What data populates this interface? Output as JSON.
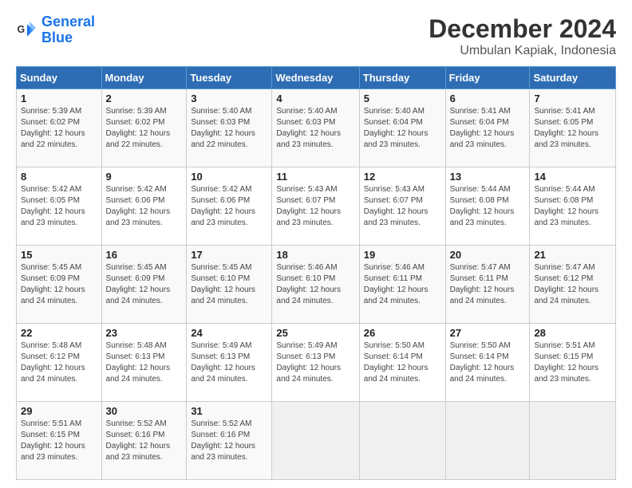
{
  "logo": {
    "text_general": "General",
    "text_blue": "Blue"
  },
  "header": {
    "title": "December 2024",
    "subtitle": "Umbulan Kapiak, Indonesia"
  },
  "calendar": {
    "days_of_week": [
      "Sunday",
      "Monday",
      "Tuesday",
      "Wednesday",
      "Thursday",
      "Friday",
      "Saturday"
    ],
    "weeks": [
      [
        null,
        {
          "day": "2",
          "sunrise": "Sunrise: 5:39 AM",
          "sunset": "Sunset: 6:02 PM",
          "daylight": "Daylight: 12 hours and 22 minutes."
        },
        {
          "day": "3",
          "sunrise": "Sunrise: 5:40 AM",
          "sunset": "Sunset: 6:03 PM",
          "daylight": "Daylight: 12 hours and 22 minutes."
        },
        {
          "day": "4",
          "sunrise": "Sunrise: 5:40 AM",
          "sunset": "Sunset: 6:03 PM",
          "daylight": "Daylight: 12 hours and 23 minutes."
        },
        {
          "day": "5",
          "sunrise": "Sunrise: 5:40 AM",
          "sunset": "Sunset: 6:04 PM",
          "daylight": "Daylight: 12 hours and 23 minutes."
        },
        {
          "day": "6",
          "sunrise": "Sunrise: 5:41 AM",
          "sunset": "Sunset: 6:04 PM",
          "daylight": "Daylight: 12 hours and 23 minutes."
        },
        {
          "day": "7",
          "sunrise": "Sunrise: 5:41 AM",
          "sunset": "Sunset: 6:05 PM",
          "daylight": "Daylight: 12 hours and 23 minutes."
        }
      ],
      [
        {
          "day": "1",
          "sunrise": "Sunrise: 5:39 AM",
          "sunset": "Sunset: 6:02 PM",
          "daylight": "Daylight: 12 hours and 22 minutes."
        },
        null,
        null,
        null,
        null,
        null,
        null
      ],
      [
        {
          "day": "8",
          "sunrise": "Sunrise: 5:42 AM",
          "sunset": "Sunset: 6:05 PM",
          "daylight": "Daylight: 12 hours and 23 minutes."
        },
        {
          "day": "9",
          "sunrise": "Sunrise: 5:42 AM",
          "sunset": "Sunset: 6:06 PM",
          "daylight": "Daylight: 12 hours and 23 minutes."
        },
        {
          "day": "10",
          "sunrise": "Sunrise: 5:42 AM",
          "sunset": "Sunset: 6:06 PM",
          "daylight": "Daylight: 12 hours and 23 minutes."
        },
        {
          "day": "11",
          "sunrise": "Sunrise: 5:43 AM",
          "sunset": "Sunset: 6:07 PM",
          "daylight": "Daylight: 12 hours and 23 minutes."
        },
        {
          "day": "12",
          "sunrise": "Sunrise: 5:43 AM",
          "sunset": "Sunset: 6:07 PM",
          "daylight": "Daylight: 12 hours and 23 minutes."
        },
        {
          "day": "13",
          "sunrise": "Sunrise: 5:44 AM",
          "sunset": "Sunset: 6:08 PM",
          "daylight": "Daylight: 12 hours and 23 minutes."
        },
        {
          "day": "14",
          "sunrise": "Sunrise: 5:44 AM",
          "sunset": "Sunset: 6:08 PM",
          "daylight": "Daylight: 12 hours and 23 minutes."
        }
      ],
      [
        {
          "day": "15",
          "sunrise": "Sunrise: 5:45 AM",
          "sunset": "Sunset: 6:09 PM",
          "daylight": "Daylight: 12 hours and 24 minutes."
        },
        {
          "day": "16",
          "sunrise": "Sunrise: 5:45 AM",
          "sunset": "Sunset: 6:09 PM",
          "daylight": "Daylight: 12 hours and 24 minutes."
        },
        {
          "day": "17",
          "sunrise": "Sunrise: 5:45 AM",
          "sunset": "Sunset: 6:10 PM",
          "daylight": "Daylight: 12 hours and 24 minutes."
        },
        {
          "day": "18",
          "sunrise": "Sunrise: 5:46 AM",
          "sunset": "Sunset: 6:10 PM",
          "daylight": "Daylight: 12 hours and 24 minutes."
        },
        {
          "day": "19",
          "sunrise": "Sunrise: 5:46 AM",
          "sunset": "Sunset: 6:11 PM",
          "daylight": "Daylight: 12 hours and 24 minutes."
        },
        {
          "day": "20",
          "sunrise": "Sunrise: 5:47 AM",
          "sunset": "Sunset: 6:11 PM",
          "daylight": "Daylight: 12 hours and 24 minutes."
        },
        {
          "day": "21",
          "sunrise": "Sunrise: 5:47 AM",
          "sunset": "Sunset: 6:12 PM",
          "daylight": "Daylight: 12 hours and 24 minutes."
        }
      ],
      [
        {
          "day": "22",
          "sunrise": "Sunrise: 5:48 AM",
          "sunset": "Sunset: 6:12 PM",
          "daylight": "Daylight: 12 hours and 24 minutes."
        },
        {
          "day": "23",
          "sunrise": "Sunrise: 5:48 AM",
          "sunset": "Sunset: 6:13 PM",
          "daylight": "Daylight: 12 hours and 24 minutes."
        },
        {
          "day": "24",
          "sunrise": "Sunrise: 5:49 AM",
          "sunset": "Sunset: 6:13 PM",
          "daylight": "Daylight: 12 hours and 24 minutes."
        },
        {
          "day": "25",
          "sunrise": "Sunrise: 5:49 AM",
          "sunset": "Sunset: 6:13 PM",
          "daylight": "Daylight: 12 hours and 24 minutes."
        },
        {
          "day": "26",
          "sunrise": "Sunrise: 5:50 AM",
          "sunset": "Sunset: 6:14 PM",
          "daylight": "Daylight: 12 hours and 24 minutes."
        },
        {
          "day": "27",
          "sunrise": "Sunrise: 5:50 AM",
          "sunset": "Sunset: 6:14 PM",
          "daylight": "Daylight: 12 hours and 24 minutes."
        },
        {
          "day": "28",
          "sunrise": "Sunrise: 5:51 AM",
          "sunset": "Sunset: 6:15 PM",
          "daylight": "Daylight: 12 hours and 23 minutes."
        }
      ],
      [
        {
          "day": "29",
          "sunrise": "Sunrise: 5:51 AM",
          "sunset": "Sunset: 6:15 PM",
          "daylight": "Daylight: 12 hours and 23 minutes."
        },
        {
          "day": "30",
          "sunrise": "Sunrise: 5:52 AM",
          "sunset": "Sunset: 6:16 PM",
          "daylight": "Daylight: 12 hours and 23 minutes."
        },
        {
          "day": "31",
          "sunrise": "Sunrise: 5:52 AM",
          "sunset": "Sunset: 6:16 PM",
          "daylight": "Daylight: 12 hours and 23 minutes."
        },
        null,
        null,
        null,
        null
      ]
    ]
  }
}
